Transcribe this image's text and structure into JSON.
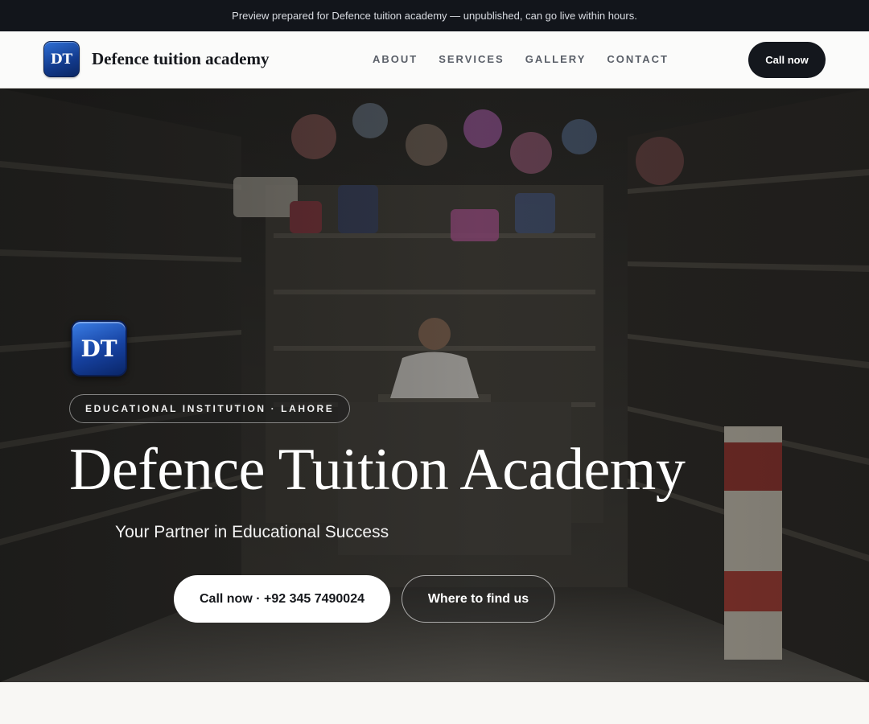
{
  "preview_bar": {
    "text": "Preview prepared for Defence tuition academy — unpublished, can go live within hours."
  },
  "header": {
    "logo_text": "DT",
    "brand_name": "Defence tuition academy",
    "nav": [
      "ABOUT",
      "SERVICES",
      "GALLERY",
      "CONTACT"
    ],
    "call_label": "Call now"
  },
  "hero": {
    "logo_text": "DT",
    "tag": "EDUCATIONAL INSTITUTION · LAHORE",
    "title": "Defence Tuition Academy",
    "subtitle": "Your Partner in Educational Success",
    "primary_button": "Call now · +92 345 7490024",
    "secondary_button": "Where to find us"
  },
  "colors": {
    "preview_bar_bg": "#12151b",
    "header_bg": "#fbfbfa",
    "call_button_bg": "#14171d",
    "logo_blue": "#1641a0",
    "page_bg": "#f8f7f4"
  }
}
